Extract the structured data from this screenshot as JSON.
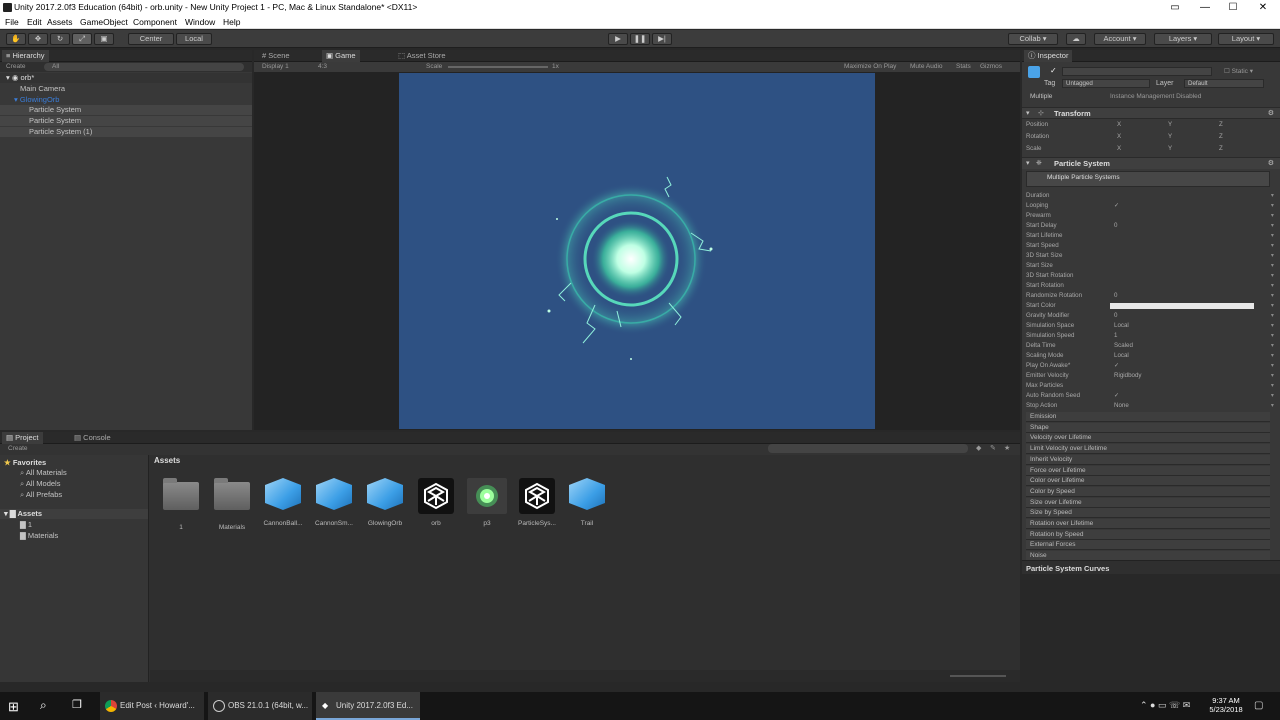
{
  "window": {
    "title": "Unity 2017.2.0f3 Education (64bit) - orb.unity - New Unity Project 1 - PC, Mac & Linux Standalone* <DX11>"
  },
  "menu": [
    "File",
    "Edit",
    "Assets",
    "GameObject",
    "Component",
    "Window",
    "Help"
  ],
  "toolbar": {
    "center": "Center",
    "local": "Local",
    "collab": "Collab",
    "account": "Account",
    "layers": "Layers",
    "layout": "Layout"
  },
  "hierarchy": {
    "tab": "Hierarchy",
    "create": "Create",
    "search": "All",
    "scene": "orb*",
    "items": [
      "Main Camera",
      "GlowingOrb",
      "Particle System",
      "Particle System",
      "Particle System (1)"
    ]
  },
  "game": {
    "tabs": [
      "Scene",
      "Game",
      "Asset Store"
    ],
    "display": "Display 1",
    "aspect": "4:3",
    "scale_label": "Scale",
    "scale_value": "1x",
    "options": [
      "Maximize On Play",
      "Mute Audio",
      "Stats",
      "Gizmos"
    ]
  },
  "inspector": {
    "tab": "Inspector",
    "static": "Static",
    "tag_label": "Tag",
    "tag": "Untagged",
    "layer_label": "Layer",
    "layer": "Default",
    "multiple": "Multiple",
    "instance": "Instance Management Disabled",
    "transform": {
      "title": "Transform",
      "rows": [
        "Position",
        "Rotation",
        "Scale"
      ],
      "axes": [
        "X",
        "Y",
        "Z"
      ]
    },
    "ps": {
      "title": "Particle System",
      "header": "Multiple Particle Systems",
      "props": [
        {
          "k": "Duration",
          "v": ""
        },
        {
          "k": "Looping",
          "v": "✓"
        },
        {
          "k": "Prewarm",
          "v": ""
        },
        {
          "k": "Start Delay",
          "v": "0"
        },
        {
          "k": "Start Lifetime",
          "v": ""
        },
        {
          "k": "Start Speed",
          "v": ""
        },
        {
          "k": "3D Start Size",
          "v": ""
        },
        {
          "k": "Start Size",
          "v": ""
        },
        {
          "k": "3D Start Rotation",
          "v": ""
        },
        {
          "k": "Start Rotation",
          "v": ""
        },
        {
          "k": "Randomize Rotation",
          "v": "0"
        },
        {
          "k": "Start Color",
          "v": ""
        },
        {
          "k": "Gravity Modifier",
          "v": "0"
        },
        {
          "k": "Simulation Space",
          "v": "Local"
        },
        {
          "k": "Simulation Speed",
          "v": "1"
        },
        {
          "k": "Delta Time",
          "v": "Scaled"
        },
        {
          "k": "Scaling Mode",
          "v": "Local"
        },
        {
          "k": "Play On Awake*",
          "v": "✓"
        },
        {
          "k": "Emitter Velocity",
          "v": "Rigidbody"
        },
        {
          "k": "Max Particles",
          "v": ""
        },
        {
          "k": "Auto Random Seed",
          "v": "✓"
        },
        {
          "k": "Stop Action",
          "v": "None"
        }
      ],
      "modules": [
        "Emission",
        "Shape",
        "Velocity over Lifetime",
        "Limit Velocity over Lifetime",
        "Inherit Velocity",
        "Force over Lifetime",
        "Color over Lifetime",
        "Color by Speed",
        "Size over Lifetime",
        "Size by Speed",
        "Rotation over Lifetime",
        "Rotation by Speed",
        "External Forces",
        "Noise"
      ],
      "curves": "Particle System Curves"
    }
  },
  "project": {
    "tabs": [
      "Project",
      "Console"
    ],
    "create": "Create",
    "favorites": "Favorites",
    "fav_items": [
      "All Materials",
      "All Models",
      "All Prefabs"
    ],
    "assets_root": "Assets",
    "tree_items": [
      "1",
      "Materials"
    ],
    "assets_header": "Assets",
    "assets": [
      "1",
      "Materials",
      "CannonBall...",
      "CannonSm...",
      "GlowingOrb",
      "orb",
      "p3",
      "ParticleSys...",
      "Trail"
    ]
  },
  "taskbar": {
    "apps": [
      "Edit Post ‹ Howard'...",
      "OBS 21.0.1 (64bit, w...",
      "Unity 2017.2.0f3 Ed..."
    ],
    "time": "9:37 AM",
    "date": "5/23/2018"
  }
}
